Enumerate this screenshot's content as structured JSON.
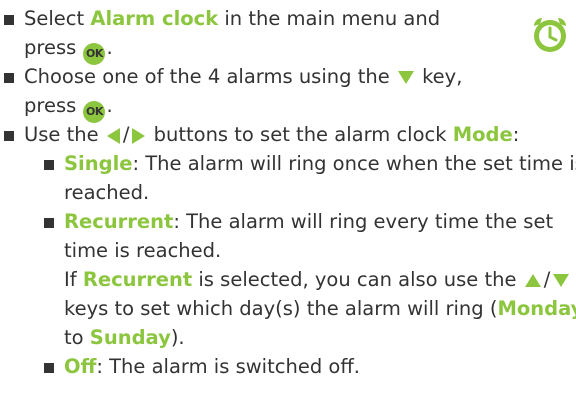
{
  "ok_label": "OK",
  "slash": "/",
  "items": {
    "select": {
      "pre": "Select ",
      "hl": "Alarm clock",
      "post": " in the main menu and",
      "l2": "press "
    },
    "choose": {
      "pre": "Choose one of the 4 alarms using the ",
      "post": " key,",
      "l2": "press "
    },
    "use": {
      "pre": "Use the ",
      "mid": " buttons to set the alarm clock ",
      "hl": "Mode",
      "post": ":"
    },
    "single": {
      "hl": "Single",
      "post": ": The alarm will ring once when the set time is",
      "l2": "reached."
    },
    "recurrent": {
      "hl": "Recurrent",
      "post": ": The alarm will ring every time the set",
      "l2": "time is reached.",
      "l3_pre": "If ",
      "l3_hl": "Recurrent",
      "l3_post": " is selected, you can also use the ",
      "l4": "keys to set which day(s) the alarm will ring (",
      "l4_hl": "Monday",
      "l5_pre": "to ",
      "l5_hl": "Sunday",
      "l5_post": ")."
    },
    "off": {
      "hl": "Off",
      "post": ": The alarm is switched off."
    }
  },
  "colors": {
    "accent": "#8cc63f",
    "text": "#333333"
  },
  "icons": [
    "alarm-clock-icon",
    "ok-button-icon",
    "down-arrow-icon",
    "up-arrow-icon",
    "left-arrow-icon",
    "right-arrow-icon"
  ]
}
